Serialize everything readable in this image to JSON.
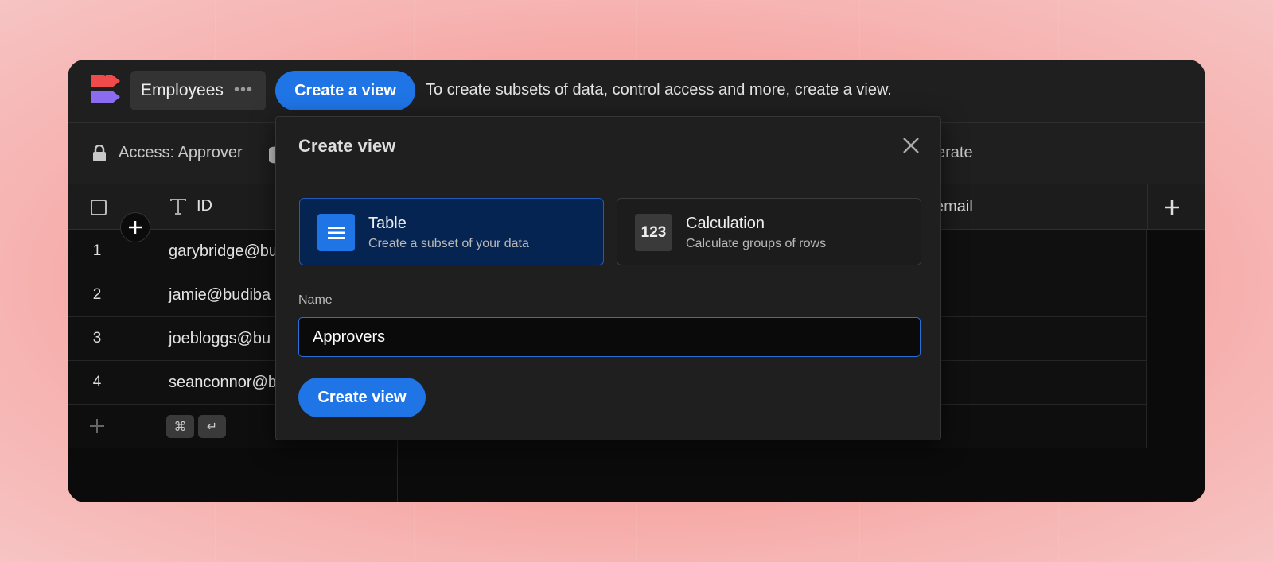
{
  "app": {
    "tab_label": "Employees",
    "tab_menu_icon": "more-dots-icon",
    "create_view_button": "Create a view",
    "hint": "To create subsets of data, control access and more, create a view."
  },
  "toolbar": {
    "access_label": "Access: Approver",
    "generate_label": "erate"
  },
  "grid": {
    "columns": [
      "ID",
      "email"
    ],
    "rows": [
      {
        "num": "1",
        "email": "garybridge@bu"
      },
      {
        "num": "2",
        "email": "jamie@budiba"
      },
      {
        "num": "3",
        "email": "joebloggs@bu"
      },
      {
        "num": "4",
        "email": "seanconnor@b"
      }
    ],
    "shortcut_keys": [
      "⌘",
      "↵"
    ]
  },
  "modal": {
    "title": "Create view",
    "options": [
      {
        "title": "Table",
        "subtitle": "Create a subset of your data",
        "icon": "list-icon",
        "selected": true
      },
      {
        "title": "Calculation",
        "subtitle": "Calculate groups of rows",
        "icon_text": "123",
        "selected": false
      }
    ],
    "name_label": "Name",
    "name_value": "Approvers",
    "submit_label": "Create view"
  },
  "colors": {
    "accent": "#1f74e6",
    "app_bg": "#0b0b0b",
    "panel_bg": "#1f1f1f",
    "selected_card_bg": "#062451",
    "page_bg": "#f47e78"
  }
}
